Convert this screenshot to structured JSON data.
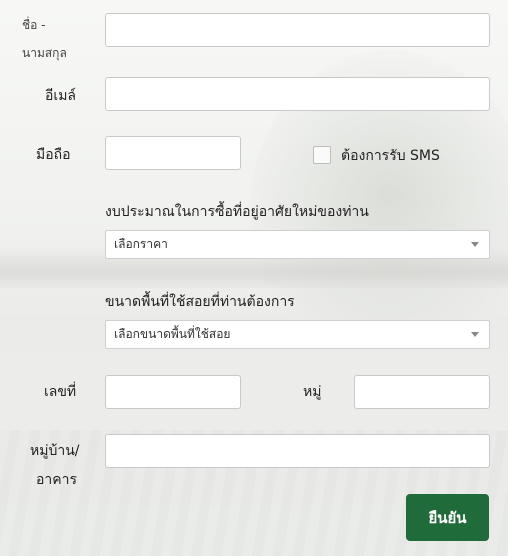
{
  "form": {
    "fullname_label_line1": "ชื่อ -",
    "fullname_label_line2": "นามสกุล",
    "email_label": "อีเมล์",
    "mobile_label": "มือถือ",
    "sms_label": "ต้องการรับ SMS",
    "budget_label": "งบประมาณในการซื้อที่อยู่อาศัยใหม่ของท่าน",
    "budget_select": "เลือกราคา",
    "area_label": "ขนาดพื้นที่ใช้สอยที่ท่านต้องการ",
    "area_select": "เลือกขนาดพื้นที่ใช้สอย",
    "house_no_label": "เลขที่",
    "moo_label": "หมู่",
    "village_label_line1": "หมู่บ้าน/",
    "village_label_line2": "อาคาร",
    "submit_label": "ยืนยัน"
  },
  "colors": {
    "submit_bg": "#1f6b3a"
  }
}
